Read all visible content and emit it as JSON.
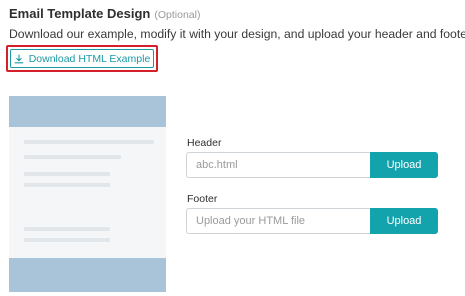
{
  "section": {
    "title": "Email Template Design",
    "optional_tag": "(Optional)",
    "description": "Download our example, modify it with your design, and upload your header and footer."
  },
  "download": {
    "label": "Download HTML Example",
    "icon": "download-icon"
  },
  "header_field": {
    "label": "Header",
    "value": "abc.html",
    "button": "Upload"
  },
  "footer_field": {
    "label": "Footer",
    "placeholder": "Upload your HTML file",
    "button": "Upload"
  },
  "colors": {
    "accent": "#12a3ad",
    "highlight": "#d4202a",
    "preview_band": "#a9c3d9"
  }
}
